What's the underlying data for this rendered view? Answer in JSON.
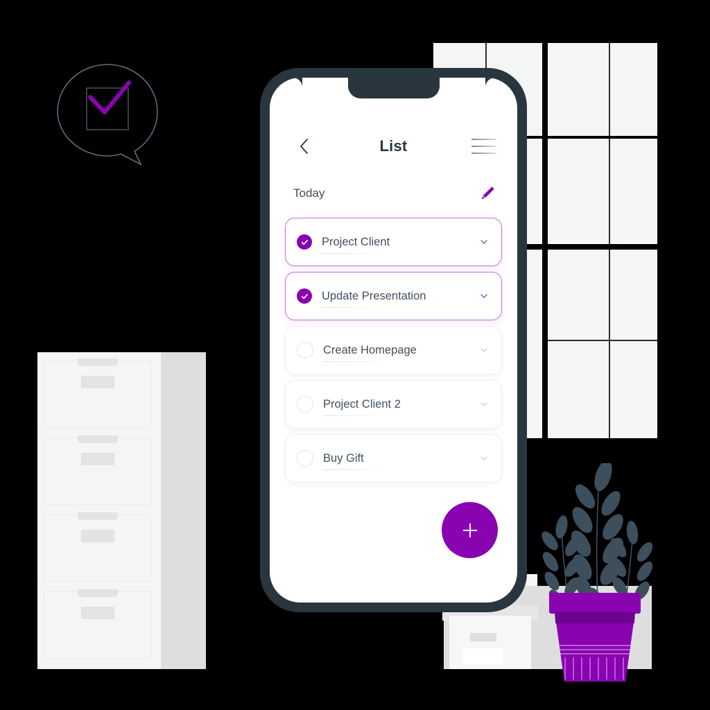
{
  "scene": {
    "background_color": "#000000",
    "accent_color": "#8A03B0",
    "frame_color": "#2A363D"
  },
  "app": {
    "header": {
      "title": "List",
      "back_icon": "chevron-left-icon",
      "menu_icon": "hamburger-menu-icon"
    },
    "section": {
      "label": "Today",
      "edit_icon": "pencil-icon"
    },
    "tasks": [
      {
        "title": "Project Client",
        "done": true,
        "chevron": "chevron-down-icon"
      },
      {
        "title": "Update Presentation",
        "done": true,
        "chevron": "chevron-down-icon"
      },
      {
        "title": "Create Homepage",
        "done": false,
        "chevron": "chevron-down-icon"
      },
      {
        "title": "Project Client 2",
        "done": false,
        "chevron": "chevron-down-icon"
      },
      {
        "title": "Buy Gift",
        "done": false,
        "chevron": "chevron-down-icon"
      }
    ],
    "fab": {
      "icon": "plus-icon",
      "color": "#8A03B0"
    }
  },
  "illustration": {
    "speech_bubble": {
      "name": "speech-bubble-with-checkbox",
      "outline_color": "#5B6F7A",
      "check_color": "#8A03B0"
    },
    "filing_cabinet": {
      "name": "filing-cabinet",
      "front_color": "#F4F5F5",
      "side_color": "#DEDEDE",
      "drawer_count": 4
    },
    "window_grid": {
      "name": "window-panels",
      "pane_color": "#F4F5F5"
    },
    "plant": {
      "name": "potted-plant",
      "leaf_color": "#3D4F5C",
      "pot_color": "#8A03B0",
      "stem_count": 3
    },
    "storage_box": {
      "name": "storage-box",
      "body_color": "#F7F7F7",
      "lid_color": "#E6E6E6"
    }
  }
}
